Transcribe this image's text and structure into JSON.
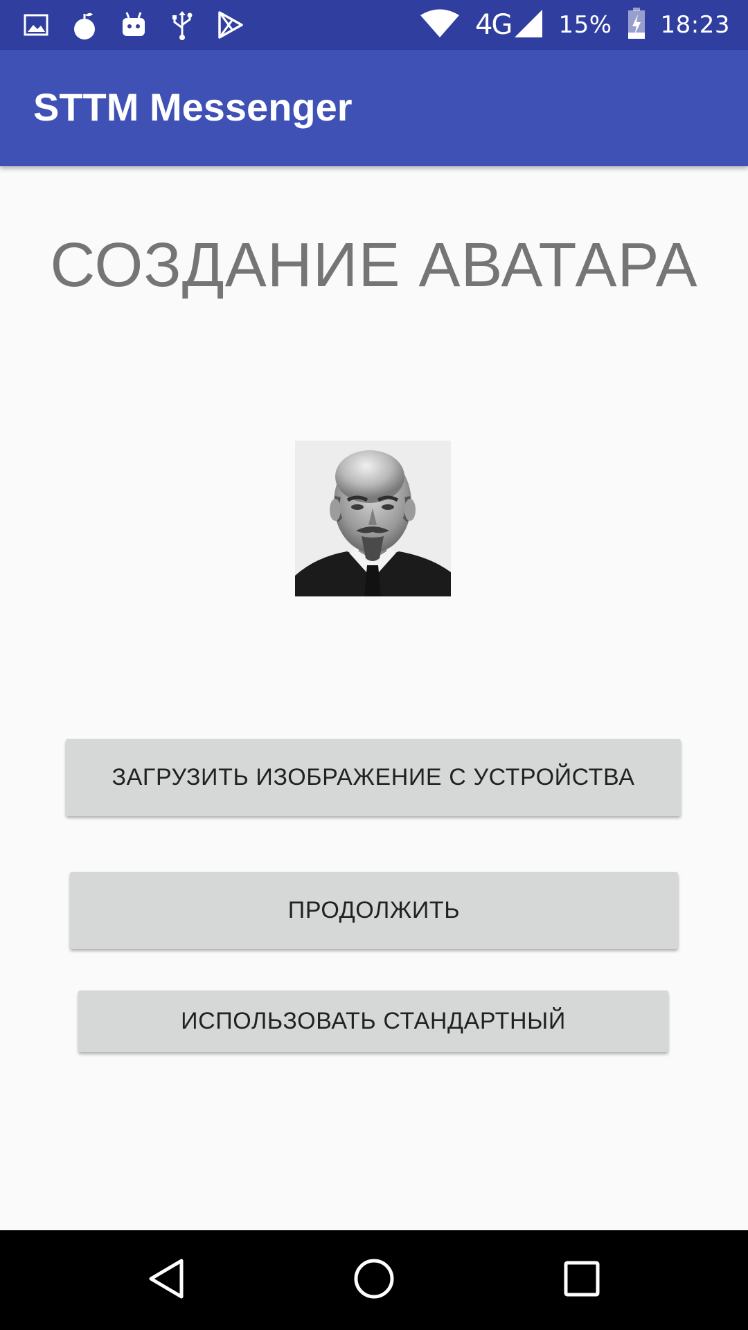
{
  "status_bar": {
    "icons_left": [
      "image-icon",
      "fruit-icon",
      "android-icon",
      "usb-icon",
      "play-store-icon"
    ],
    "network": "4G",
    "battery": "15%",
    "time": "18:23"
  },
  "app_bar": {
    "title": "STTM Messenger"
  },
  "main": {
    "heading": "СОЗДАНИЕ АВАТАРА",
    "buttons": {
      "upload": "ЗАГРУЗИТЬ ИЗОБРАЖЕНИЕ С УСТРОЙСТВА",
      "continue": "ПРОДОЛЖИТЬ",
      "use_default": "ИСПОЛЬЗОВАТЬ СТАНДАРТНЫЙ"
    }
  },
  "nav_bar": {
    "icons": [
      "back-icon",
      "home-icon",
      "recent-apps-icon"
    ]
  },
  "colors": {
    "status_bar": "#303f9f",
    "app_bar": "#3f51b5",
    "background": "#fafafa",
    "heading": "#757575",
    "button": "#d6d7d7"
  }
}
